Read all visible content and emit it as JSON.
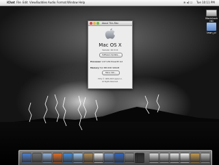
{
  "menubar": {
    "apple_glyph": "",
    "app_name": "iChat",
    "items": [
      "File",
      "Edit",
      "View",
      "Buddies",
      "Audio",
      "Format",
      "Window",
      "Help"
    ],
    "status_icons": "≋ ◂) ☐",
    "clock": "Tue 10:11 PM"
  },
  "desktop_icons": [
    {
      "label": "Macintosh HD",
      "icon": "hard-drive-icon"
    },
    {
      "label": "lawn_pl",
      "icon": "folder-icon"
    }
  ],
  "about_window": {
    "title": "About This Mac",
    "os_name": "Mac OS X",
    "version": "Version 10.3.11",
    "software_update_label": "Software Update...",
    "processor_label": "Processor",
    "processor_value": "1.67 GHz PowerPC G4",
    "memory_label": "Memory",
    "memory_value": "512 MB DDR SDRAM",
    "more_info_label": "More Info...",
    "tm_line": "TM & © 1983-2005 Apple Inc.",
    "rights_line": "All Rights Reserved."
  },
  "dock": {
    "items": [
      {
        "icon": "finder-icon",
        "color": "#4a7fd4"
      },
      {
        "icon": "dashboard-icon",
        "color": "#6d6d6d"
      },
      {
        "icon": "mail-icon",
        "color": "#8fb3e0"
      },
      {
        "icon": "firefox-icon",
        "color": "#e36b1f"
      },
      {
        "icon": "ichat-icon",
        "color": "#3f8de0"
      },
      {
        "icon": "itunes-icon",
        "color": "#9ec9f0"
      },
      {
        "icon": "address-book-icon",
        "color": "#b08a52"
      },
      {
        "icon": "ical-icon",
        "color": "#f2f2f2"
      },
      {
        "icon": "preview-icon",
        "color": "#7a9ac8"
      },
      {
        "icon": "quicktime-icon",
        "color": "#2b64c7"
      },
      {
        "icon": "system-preferences-icon",
        "color": "#8d8d8d"
      },
      {
        "icon": "terminal-icon",
        "color": "#222222"
      },
      {
        "icon": "window-thumbnail-1",
        "color": "#dcdcdc"
      },
      {
        "icon": "window-thumbnail-2",
        "color": "#cfcfcf"
      },
      {
        "icon": "window-thumbnail-3",
        "color": "#e8e8e8"
      },
      {
        "icon": "document-icon",
        "color": "#f5f5f5"
      },
      {
        "icon": "photo-icon",
        "color": "#c79a4a"
      },
      {
        "icon": "trash-icon",
        "color": "#bdbdbd"
      }
    ]
  }
}
